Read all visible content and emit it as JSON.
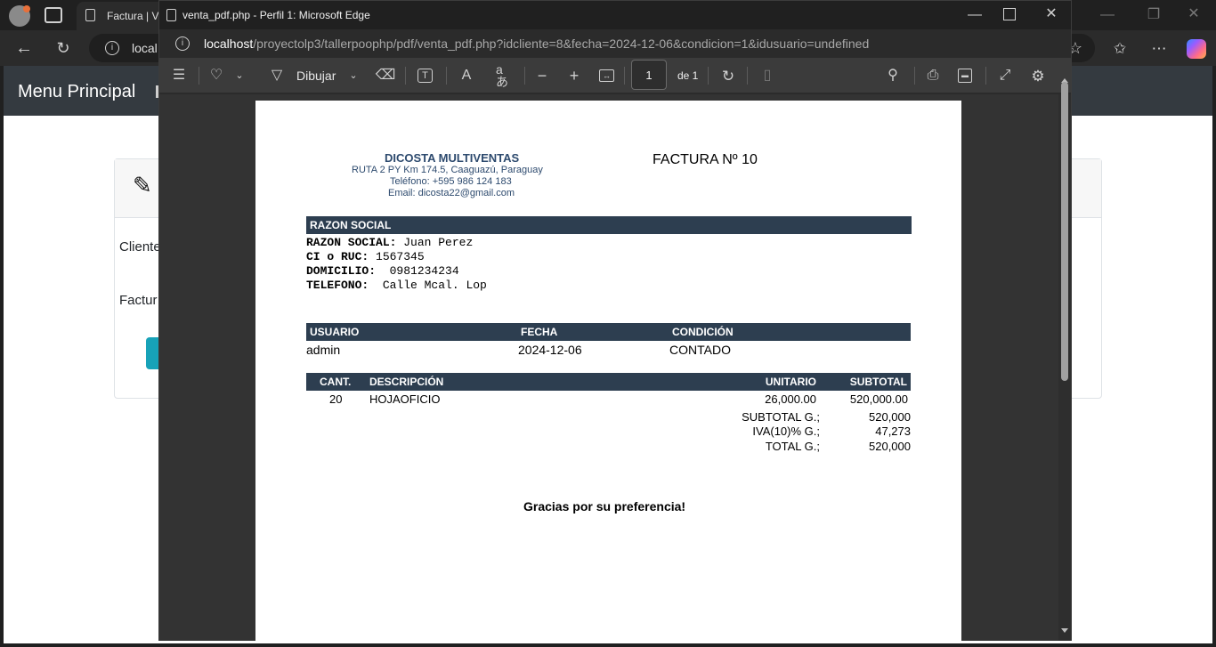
{
  "bg_browser": {
    "tab_title": "Factura | Ve",
    "address": "local",
    "navbar_brand": "Menu Principal",
    "form_label_cliente": "Cliente",
    "form_label_factura": "Factur"
  },
  "popup": {
    "title": "venta_pdf.php - Perfil 1: Microsoft Edge",
    "url_host": "localhost",
    "url_path": "/proyectolp3/tallerpoophp/pdf/venta_pdf.php?idcliente=8&fecha=2024-12-06&condicion=1&idusuario=undefined"
  },
  "pdf_toolbar": {
    "draw_label": "Dibujar",
    "page_number": "1",
    "page_total": "de 1"
  },
  "invoice": {
    "company_name": "DICOSTA MULTIVENTAS",
    "address": "RUTA 2 PY Km 174.5, Caaguazú, Paraguay",
    "phone": "Teléfono: +595 986 124 183",
    "email": "Email: dicosta22@gmail.com",
    "invoice_title": "FACTURA Nº 10",
    "razon_header": "RAZON SOCIAL",
    "razon_label": "RAZON SOCIAL:",
    "razon_value": "Juan Perez",
    "ci_label": "CI o RUC:",
    "ci_value": "1567345",
    "domicilio_label": "DOMICILIO:",
    "domicilio_value": "0981234234",
    "telefono_label": "TELEFONO:",
    "telefono_value": "Calle Mcal. Lop",
    "col_usuario": "USUARIO",
    "col_fecha": "FECHA",
    "col_condicion": "CONDICIÓN",
    "usuario": "admin",
    "fecha": "2024-12-06",
    "condicion": "CONTADO",
    "items_headers": {
      "cant": "CANT.",
      "descripcion": "DESCRIPCIÓN",
      "unitario": "UNITARIO",
      "subtotal": "SUBTOTAL"
    },
    "items": [
      {
        "cant": "20",
        "descripcion": "HOJAOFICIO",
        "unitario": "26,000.00",
        "subtotal": "520,000.00"
      }
    ],
    "subtotal_label": "SUBTOTAL G.;",
    "subtotal_value": "520,000",
    "iva_label": "IVA(10)% G.;",
    "iva_value": "47,273",
    "total_label": "TOTAL G.;",
    "total_value": "520,000",
    "thanks": "Gracias por su preferencia!"
  }
}
